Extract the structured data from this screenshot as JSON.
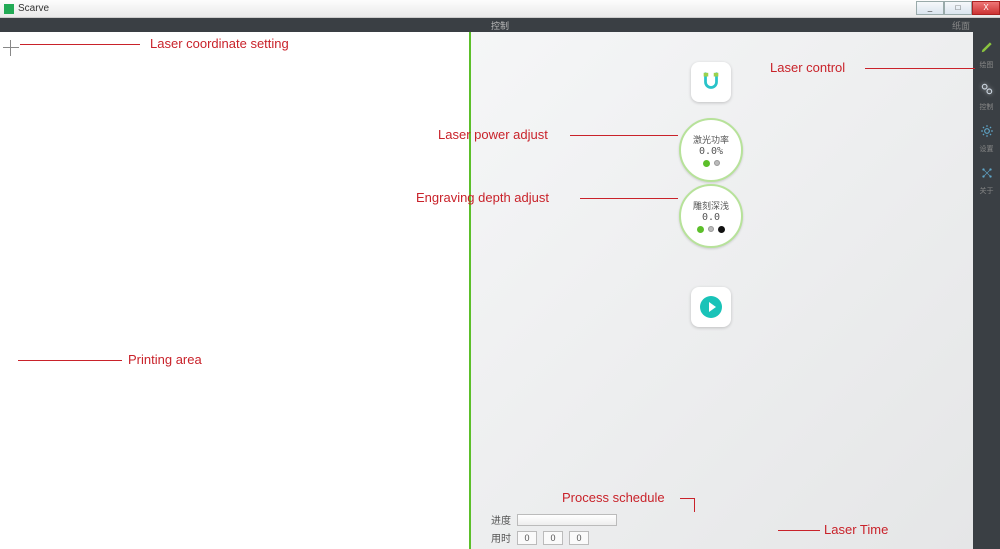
{
  "window": {
    "title": "Scarve",
    "min": "_",
    "max": "□",
    "close": "X"
  },
  "topbar": {
    "center": "控制",
    "right": "纸面"
  },
  "sidebar": {
    "items": [
      {
        "name": "draw",
        "label": "绘图"
      },
      {
        "name": "control",
        "label": "控制"
      },
      {
        "name": "settings",
        "label": "设置"
      },
      {
        "name": "about",
        "label": "关于"
      }
    ]
  },
  "dials": {
    "power": {
      "label": "激光功率",
      "value": "0.0%"
    },
    "depth": {
      "label": "雕刻深浅",
      "value": "0.0"
    }
  },
  "bottom": {
    "progress_label": "进度",
    "time_label": "用时",
    "time_values": [
      "0",
      "0",
      "0"
    ]
  },
  "annotations": {
    "coord": "Laser coordinate setting",
    "power": "Laser power adjust",
    "depth": "Engraving depth adjust",
    "print": "Printing area",
    "ctrl": "Laser control",
    "sched": "Process schedule",
    "time": "Laser Time"
  }
}
